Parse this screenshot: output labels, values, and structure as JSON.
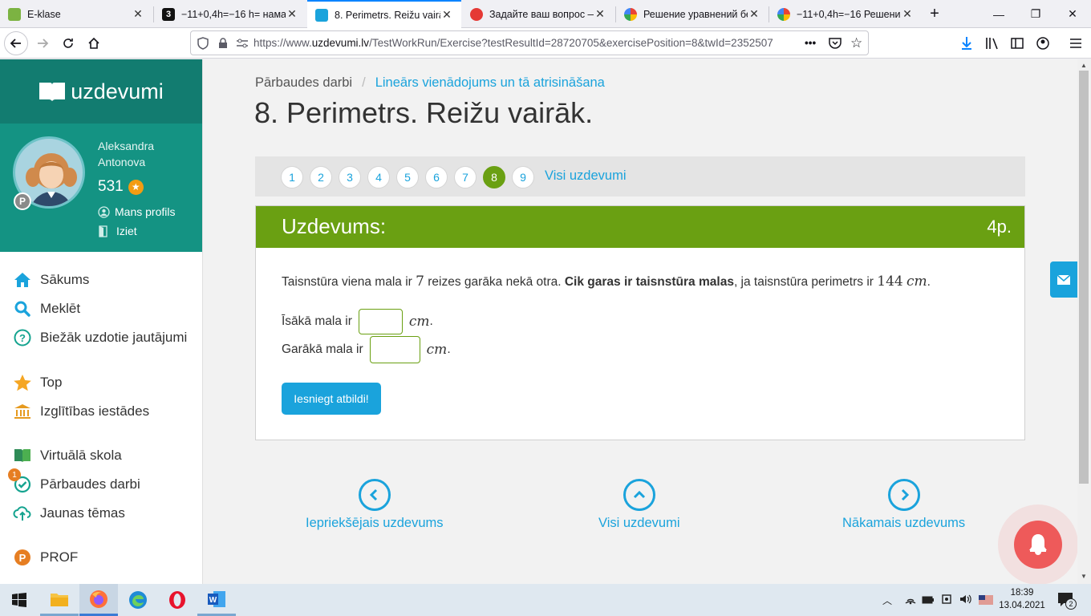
{
  "browser": {
    "tabs": [
      {
        "title": "E-klase",
        "active": false
      },
      {
        "title": "−11+0,4h=−16 h= намаг",
        "active": false
      },
      {
        "title": "8. Perimetrs. Reižu vairāk.",
        "active": true
      },
      {
        "title": "Задайте ваш вопрос —",
        "active": false
      },
      {
        "title": "Решение уравнений бе",
        "active": false
      },
      {
        "title": "−11+0,4h=−16 Решение",
        "active": false
      }
    ],
    "url_prefix": "https://www.",
    "url_domain": "uzdevumi.lv",
    "url_path": "/TestWorkRun/Exercise?testResultId=28720705&exercisePosition=8&twId=2352507",
    "more_icon": "•••"
  },
  "sidebar": {
    "logo_text": "uzdevumi",
    "user_first": "Aleksandra",
    "user_last": "Antonova",
    "points": "531",
    "profile_link": "Mans profils",
    "logout_link": "Iziet",
    "badge_letter": "P",
    "menu": [
      {
        "label": "Sākums",
        "icon": "home-icon"
      },
      {
        "label": "Meklēt",
        "icon": "search-icon"
      },
      {
        "label": "Biežāk uzdotie jautājumi",
        "icon": "question-icon"
      },
      {
        "label": "Top",
        "icon": "star-icon"
      },
      {
        "label": "Izglītības iestādes",
        "icon": "institution-icon"
      },
      {
        "label": "Virtuālā skola",
        "icon": "book-icon"
      },
      {
        "label": "Pārbaudes darbi",
        "icon": "check-icon",
        "badge": "1"
      },
      {
        "label": "Jaunas tēmas",
        "icon": "cloud-icon"
      },
      {
        "label": "PROF",
        "icon": "prof-icon"
      }
    ]
  },
  "main": {
    "breadcrumb_root": "Pārbaudes darbi",
    "breadcrumb_sep": "/",
    "breadcrumb_current": "Lineārs vienādojums un tā atrisināšana",
    "title": "8. Perimetrs. Reižu vairāk.",
    "pages": [
      "1",
      "2",
      "3",
      "4",
      "5",
      "6",
      "7",
      "8",
      "9"
    ],
    "active_page": "8",
    "all_tasks_link": "Visi uzdevumi",
    "task_header": "Uzdevums:",
    "task_points": "4p.",
    "problem": {
      "t1": "Taisnstūra viena mala ir ",
      "n1": "7",
      "t2": " reizes garāka nekā otra. ",
      "bold": "Cik garas ir taisnstūra malas",
      "t3": ", ja taisnstūra perimetrs ir ",
      "n2": "144",
      "unit": "cm",
      "end": "."
    },
    "short_label": "Īsākā mala ir",
    "long_label": "Garākā mala ir",
    "short_value": "",
    "long_value": "",
    "unit": "cm",
    "unit_end": ".",
    "submit": "Iesniegt atbildi!",
    "prev": "Iepriekšējais uzdevums",
    "all": "Visi uzdevumi",
    "next": "Nākamais uzdevums"
  },
  "taskbar": {
    "time": "18:39",
    "date": "13.04.2021",
    "notif_count": "2"
  },
  "colors": {
    "accent_green": "#6aa012",
    "link_blue": "#1aa3dc",
    "teal_dark": "#127c70",
    "teal": "#149383"
  }
}
